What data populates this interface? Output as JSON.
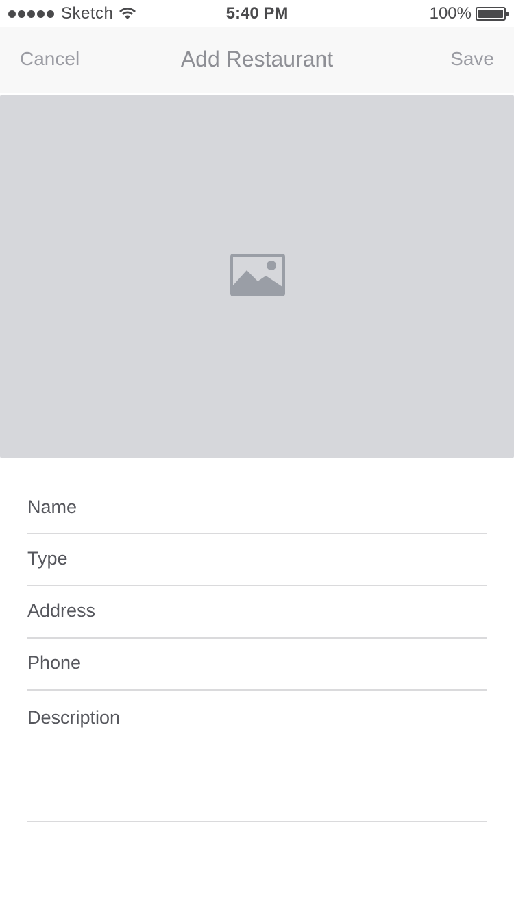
{
  "status_bar": {
    "carrier": "Sketch",
    "time": "5:40 PM",
    "battery": "100%"
  },
  "nav": {
    "cancel": "Cancel",
    "title": "Add Restaurant",
    "save": "Save"
  },
  "image_placeholder": {
    "icon": "image-icon",
    "color": "#d6d7db"
  },
  "form": {
    "fields": [
      {
        "label": "Name"
      },
      {
        "label": "Type"
      },
      {
        "label": "Address"
      },
      {
        "label": "Phone"
      },
      {
        "label": "Description"
      }
    ]
  }
}
